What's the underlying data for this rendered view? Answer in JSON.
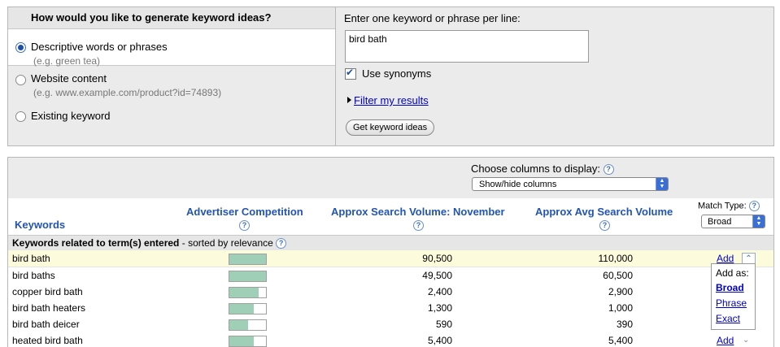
{
  "idea_source": {
    "question": "How would you like to generate keyword ideas?",
    "options": [
      {
        "label": "Descriptive words or phrases",
        "example": "(e.g. green tea)",
        "selected": true
      },
      {
        "label": "Website content",
        "example": "(e.g. www.example.com/product?id=74893)",
        "selected": false
      },
      {
        "label": "Existing keyword",
        "example": "",
        "selected": false
      }
    ]
  },
  "keyword_entry": {
    "label": "Enter one keyword or phrase per line:",
    "value": "bird bath",
    "use_synonyms_label": "Use synonyms",
    "use_synonyms_checked": true,
    "filter_link": "Filter my results",
    "submit_label": "Get keyword ideas"
  },
  "columns": {
    "label": "Choose columns to display:",
    "select_value": "Show/hide columns"
  },
  "headers": {
    "keywords": "Keywords",
    "competition": "Advertiser Competition",
    "search_nov": "Approx Search Volume: November",
    "search_avg": "Approx Avg Search Volume",
    "match_type_label": "Match Type:",
    "match_type_value": "Broad"
  },
  "group": {
    "title": "Keywords related to term(s) entered",
    "subtitle": "- sorted by relevance"
  },
  "help_glyph": "?",
  "rows": [
    {
      "keyword": "bird bath",
      "competition": 1.0,
      "nov": "90,500",
      "avg": "110,000",
      "add": "Add"
    },
    {
      "keyword": "bird baths",
      "competition": 1.0,
      "nov": "49,500",
      "avg": "60,500",
      "add": ""
    },
    {
      "keyword": "copper bird bath",
      "competition": 0.8,
      "nov": "2,400",
      "avg": "2,900",
      "add": ""
    },
    {
      "keyword": "bird bath heaters",
      "competition": 0.66,
      "nov": "1,300",
      "avg": "1,000",
      "add": ""
    },
    {
      "keyword": "bird bath deicer",
      "competition": 0.5,
      "nov": "590",
      "avg": "390",
      "add": ""
    },
    {
      "keyword": "heated bird bath",
      "competition": 0.66,
      "nov": "5,400",
      "avg": "5,400",
      "add": "Add"
    }
  ],
  "add_as_popup": {
    "title": "Add as:",
    "options": [
      "Broad",
      "Phrase",
      "Exact"
    ]
  }
}
